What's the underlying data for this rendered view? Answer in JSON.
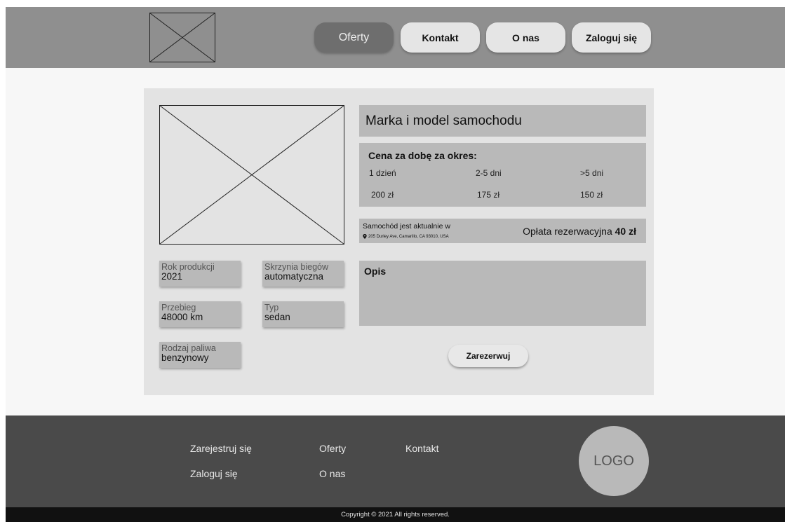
{
  "nav": {
    "offers": "Oferty",
    "contact": "Kontakt",
    "about": "O nas",
    "login": "Zaloguj się"
  },
  "car": {
    "title": "Marka i model samochodu",
    "specs": {
      "year_label": "Rok produkcji",
      "year": "2021",
      "gearbox_label": "Skrzynia biegów",
      "gearbox": "automatyczna",
      "mileage_label": "Przebieg",
      "mileage": "48000 km",
      "type_label": "Typ",
      "type": "sedan",
      "fuel_label": "Rodzaj paliwa",
      "fuel": "benzynowy"
    },
    "price": {
      "title": "Cena za dobę za okres:",
      "periods": [
        "1 dzień",
        "2-5 dni",
        ">5 dni"
      ],
      "values": [
        "200 zł",
        "175 zł",
        "150 zł"
      ]
    },
    "location": {
      "label": "Samochód jest aktualnie w",
      "address": "205 Durley Ave, Camarillo, CA 93010, USA",
      "icon": "map-pin-icon"
    },
    "fee": {
      "label": "Opłata rezerwacyjna",
      "amount": "40 zł"
    },
    "description_label": "Opis",
    "reserve_label": "Zarezerwuj"
  },
  "footer": {
    "register": "Zarejestruj się",
    "login": "Zaloguj się",
    "offers": "Oferty",
    "about": "O nas",
    "contact": "Kontakt",
    "logo": "LOGO",
    "copyright": "Copyright © 2021 All rights reserved."
  },
  "colors": {
    "header_bg": "#8f8f8f",
    "nav_active": "#6e6e6e",
    "nav_button": "#e5e5e5",
    "card_bg": "#e3e3e3",
    "box_bg": "#b9b9b9",
    "footer_bg": "#4a4a4a",
    "copyright_bg": "#111111"
  }
}
